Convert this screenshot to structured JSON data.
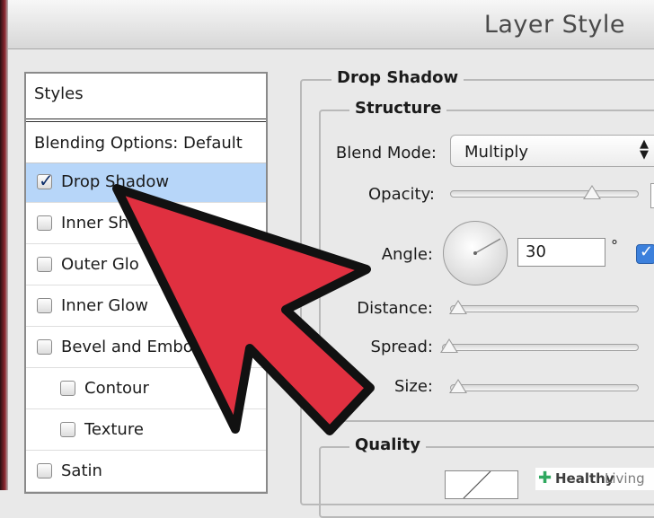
{
  "window": {
    "title": "Layer Style"
  },
  "styles_panel": {
    "header": "Styles",
    "blending": "Blending Options: Default",
    "items": [
      {
        "label": "Drop Shadow",
        "checked": true,
        "selected": true
      },
      {
        "label": "Inner Sh",
        "checked": false
      },
      {
        "label": "Outer Glo",
        "checked": false
      },
      {
        "label": "Inner Glow",
        "checked": false
      },
      {
        "label": "Bevel and Embo",
        "checked": false
      },
      {
        "label": "Contour",
        "checked": false
      },
      {
        "label": "Texture",
        "checked": false
      },
      {
        "label": "Satin",
        "checked": false
      }
    ]
  },
  "drop_shadow": {
    "title": "Drop Shadow",
    "structure": {
      "title": "Structure",
      "blend_mode_label": "Blend Mode:",
      "blend_mode_value": "Multiply",
      "opacity_label": "Opacity:",
      "opacity_level": 0.75,
      "angle_label": "Angle:",
      "angle_value": "30",
      "degree_symbol": "°",
      "use_global_light_checked": true,
      "distance_label": "Distance:",
      "spread_label": "Spread:",
      "size_label": "Size:"
    },
    "quality": {
      "title": "Quality"
    }
  },
  "watermark": {
    "part1": "Healthy",
    "part2": "Living",
    "icon": "plus-cross-icon"
  },
  "overlay": {
    "arrow_color": "#e03040",
    "outline_color": "#111111"
  }
}
